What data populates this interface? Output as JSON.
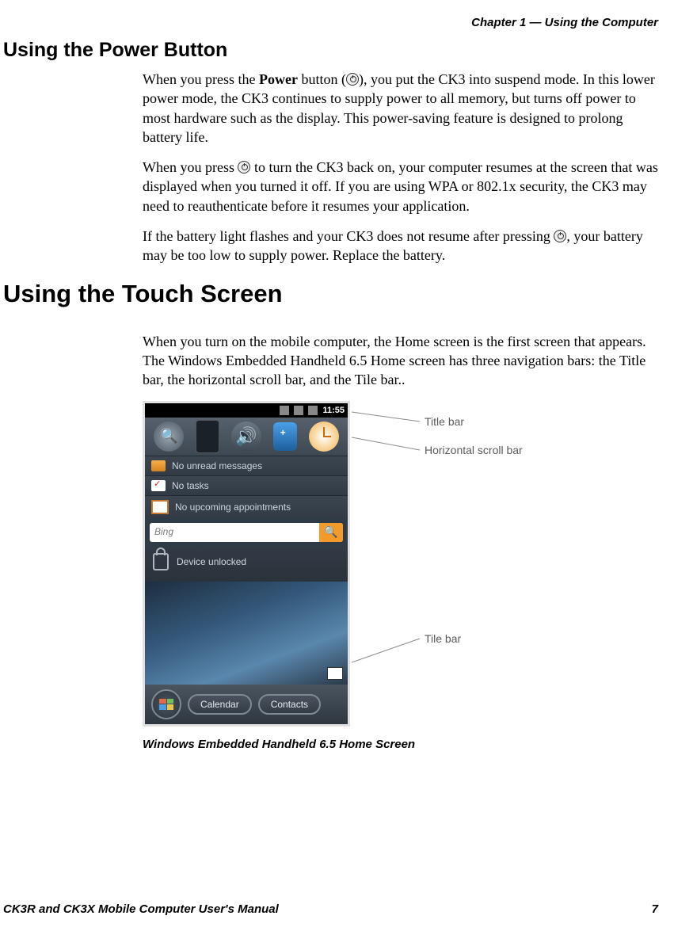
{
  "header": {
    "chapter": "Chapter 1 — Using the Computer"
  },
  "section1": {
    "title": "Using the Power Button",
    "p1a": "When you press the ",
    "p1b": "Power",
    "p1c": " button (",
    "p1d": "), you put the CK3 into suspend mode. In this lower power mode, the CK3 continues to supply power to all memory, but turns off power to most hardware such as the display. This power-saving feature is designed to prolong battery life.",
    "p2a": "When you press ",
    "p2b": " to turn the CK3 back on, your computer resumes at the screen that was displayed when you turned it off. If you are using WPA or 802.1x security, the CK3 may need to reauthenticate before it resumes your application.",
    "p3a": "If the battery light flashes and your CK3 does not resume after pressing ",
    "p3b": ", your battery may be too low to supply power. Replace the battery."
  },
  "section2": {
    "title": "Using the Touch Screen",
    "p1": "When you turn on the mobile computer, the Home screen is the first screen that appears. The Windows Embedded Handheld 6.5 Home screen has three navigation bars: the Title bar, the horizontal scroll bar, and the Tile bar.."
  },
  "screenshot": {
    "titlebar": {
      "time": "11:55"
    },
    "rows": {
      "messages": "No unread messages",
      "tasks": "No tasks",
      "appointments": "No upcoming appointments"
    },
    "search": {
      "placeholder": "Bing",
      "go_icon": "🔍"
    },
    "lock": "Device unlocked",
    "tilebar": {
      "btn1": "Calendar",
      "btn2": "Contacts"
    },
    "callouts": {
      "title_bar": "Title bar",
      "scroll_bar": "Horizontal scroll bar",
      "tile_bar": "Tile bar"
    },
    "caption": "Windows Embedded Handheld 6.5 Home Screen"
  },
  "footer": {
    "manual": "CK3R and CK3X Mobile Computer User's Manual",
    "page": "7"
  }
}
